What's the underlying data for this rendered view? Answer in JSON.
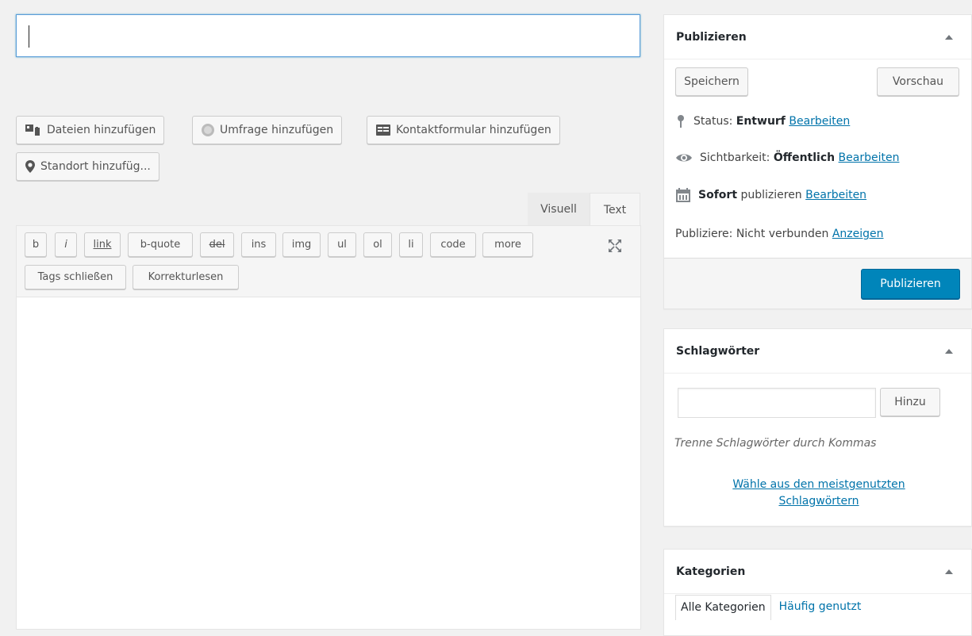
{
  "editor": {
    "title_placeholder": "",
    "media_buttons": [
      {
        "label": "Dateien hinzufügen",
        "icon": "media-icon"
      },
      {
        "label": "Umfrage hinzufügen",
        "icon": "poll-icon"
      },
      {
        "label": "Kontaktformular hinzufügen",
        "icon": "form-icon"
      },
      {
        "label": "Standort hinzufüg...",
        "icon": "location-pin-icon"
      }
    ],
    "tabs": {
      "visual": "Visuell",
      "text": "Text"
    },
    "quicktags": [
      "b",
      "i",
      "link",
      "b-quote",
      "del",
      "ins",
      "img",
      "ul",
      "ol",
      "li",
      "code",
      "more",
      "Tags schließen",
      "Korrekturlesen"
    ],
    "content": ""
  },
  "publish_box": {
    "title": "Publizieren",
    "save_draft": "Speichern",
    "preview": "Vorschau",
    "status_label": "Status:",
    "status_value": "Entwurf",
    "visibility_label": "Sichtbarkeit:",
    "visibility_value": "Öffentlich",
    "schedule_bold": "Sofort",
    "schedule_text": "publizieren",
    "edit_link": "Bearbeiten",
    "publicize_text": "Publiziere: Nicht verbunden",
    "publicize_link": "Anzeigen",
    "publish_button": "Publizieren"
  },
  "tags_box": {
    "title": "Schlagwörter",
    "input_value": "",
    "add_button": "Hinzu",
    "hint": "Trenne Schlagwörter durch Kommas",
    "choose_link": "Wähle aus den meistgenutzten Schlagwörtern"
  },
  "categories_box": {
    "title": "Kategorien",
    "tab_all": "Alle Kategorien",
    "tab_popular": "Häufig genutzt"
  },
  "colors": {
    "primary": "#0085ba",
    "link": "#0073aa",
    "background": "#f1f1f1",
    "focus_border": "#5b9dd9"
  }
}
